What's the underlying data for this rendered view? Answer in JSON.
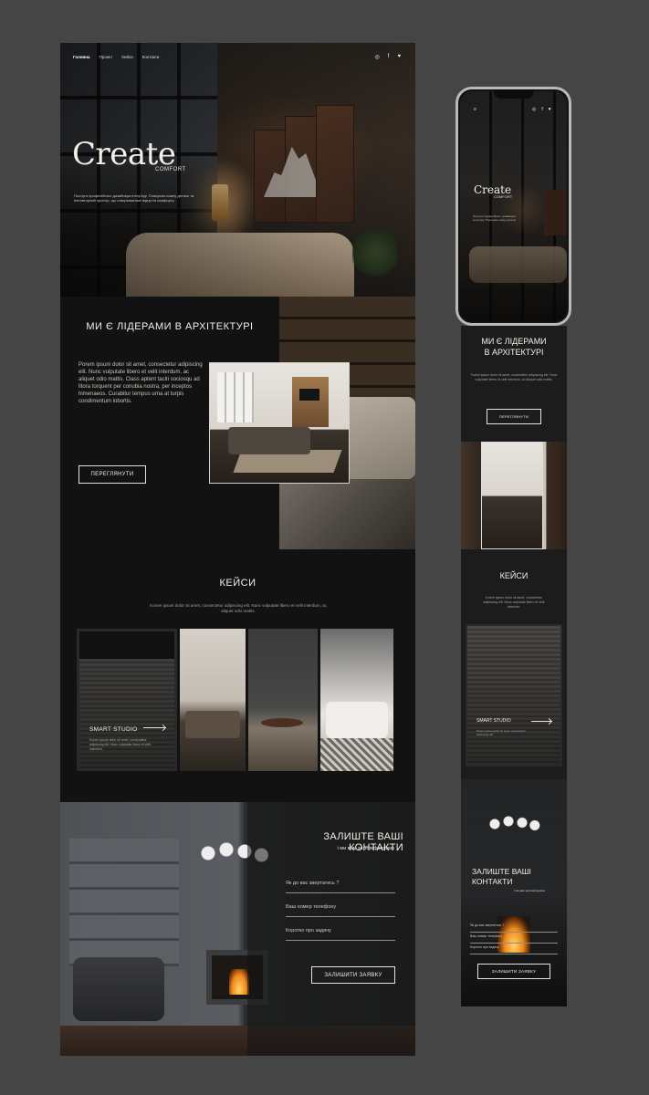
{
  "desktop": {
    "nav": [
      "Головна",
      "Проект",
      "Кейси",
      "Контакти"
    ],
    "socials": [
      "◎",
      "f",
      "♥"
    ],
    "hero": {
      "title": "Create",
      "subtitle": "COMFORT",
      "description": "Послуги професійного дизайнера інтер'єру. Плануємо кожну деталь та неповторний простір, що створюватиме відчуття комфорту."
    },
    "leaders": {
      "title": "МИ Є ЛІДЕРАМИ В АРХІТЕКТУРІ",
      "body": "Porem ipsum dolor sit amet, consectetur adipiscing elit. Nunc vulputate libero et velit interdum, ac aliquet odio mattis. Class aptent taciti sociosqu ad litora torquent per conubia nostra, per inceptos himenaeos. Curabitur tempus urna at turpis condimentum lobortis.",
      "button": "ПЕРЕГЛЯНУТИ"
    },
    "cases": {
      "title": "КЕЙСИ",
      "description": "Korem ipsum dolor sit amet, consectetur adipiscing elit. Nunc vulputate libero et velit interdum, ac aliquet odio mattis.",
      "featured_label": "SMART STUDIO",
      "featured_text": "Korem ipsum dolor sit amet, consectetur adipiscing elit. Nunc vulputate libero et velit interdum."
    },
    "contact": {
      "title": "ЗАЛИШТЕ ВАШІ КОНТАКТИ",
      "subtitle": "і ми вам зателефонуємо",
      "fields": [
        "Як до вас звертатись ?",
        "Ваш номер телефону",
        "Коротко про задачу"
      ],
      "button": "ЗАЛИШИТИ ЗАЯВКУ"
    }
  },
  "mobile": {
    "logo": "≡",
    "socials": [
      "◎",
      "f",
      "♥"
    ],
    "hero_title": "Create",
    "hero_subtitle": "COMFORT",
    "hero_description": "Послуги професійного дизайнера інтер'єру. Плануємо кожну деталь.",
    "leaders_title_1": "МИ Є ЛІДЕРАМИ",
    "leaders_title_2": "В АРХІТЕКТУРІ",
    "leaders_body": "Porem ipsum dolor sit amet, consectetur adipiscing elit. Nunc vulputate libero et velit interdum, ac aliquet odio mattis.",
    "leaders_button": "ПЕРЕГЛЯНУТИ",
    "cases_title": "КЕЙСИ",
    "cases_body": "Korem ipsum dolor sit amet, consectetur adipiscing elit. Nunc vulputate libero et velit interdum.",
    "case_label": "SMART STUDIO",
    "case_text": "Korem ipsum dolor sit amet, consectetur adipiscing elit.",
    "contact_title_1": "ЗАЛИШТЕ ВАШІ",
    "contact_title_2": "КОНТАКТИ",
    "contact_subtitle": "і ми вам зателефонуємо",
    "contact_fields": [
      "Як до вас звертатись ?",
      "Ваш номер телефону",
      "Коротко про задачу"
    ],
    "contact_button": "ЗАЛИШИТИ ЗАЯВКУ"
  }
}
